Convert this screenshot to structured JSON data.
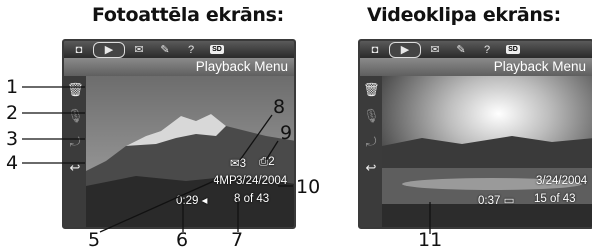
{
  "captions": {
    "photo": "Fotoattēla ekrāns:",
    "video": "Videoklipa ekrāns:"
  },
  "menu_title": "Playback Menu",
  "tabs": [
    "camera-icon",
    "playback-icon",
    "email-icon",
    "setup-icon",
    "help-icon",
    "sd-card-icon"
  ],
  "sd_label": "SD",
  "photo_screen": {
    "email_count": "3",
    "print_count": "2",
    "resolution": "4MP",
    "date": "3/24/2004",
    "audio_time": "0:29",
    "image_index": "8 of 43"
  },
  "video_screen": {
    "date": "3/24/2004",
    "duration": "0:37",
    "image_index": "15 of 43"
  },
  "side_menu": [
    "delete-icon",
    "record-audio-icon",
    "rotate-icon",
    "back-icon"
  ],
  "callouts": [
    "1",
    "2",
    "3",
    "4",
    "5",
    "6",
    "7",
    "8",
    "9",
    "10",
    "11"
  ]
}
